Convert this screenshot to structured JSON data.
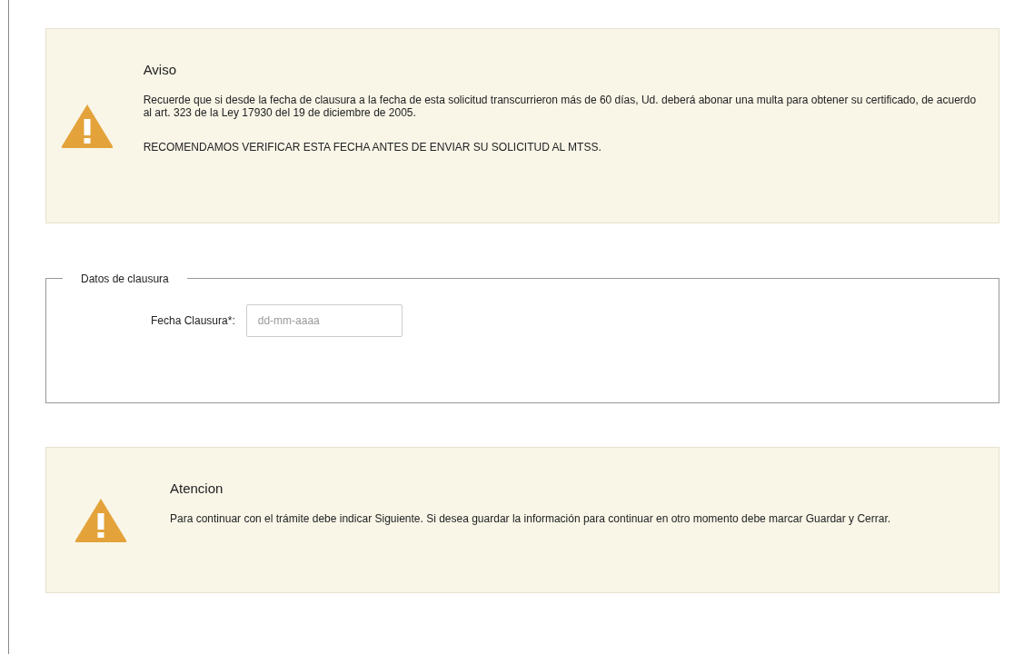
{
  "notices": [
    {
      "kind": "warning",
      "title": "Aviso",
      "paragraphs": [
        "Recuerde que si desde la fecha de clausura a la fecha de esta solicitud transcurrieron más de 60 días, Ud. deberá abonar una multa para obtener su certificado, de acuerdo al art. 323 de la Ley 17930 del 19 de diciembre de 2005.",
        "RECOMENDAMOS VERIFICAR ESTA FECHA ANTES DE ENVIAR SU SOLICITUD AL MTSS."
      ]
    },
    {
      "kind": "fieldset",
      "legend": "Datos de clausura",
      "field": {
        "label": "Fecha Clausura*:",
        "placeholder": "dd-mm-aaaa"
      }
    },
    {
      "kind": "warning",
      "title": "Atencion",
      "paragraphs": [
        "Para continuar con el trámite debe indicar Siguiente. Si desea guardar la información para continuar en otro momento debe marcar Guardar y Cerrar."
      ]
    }
  ]
}
